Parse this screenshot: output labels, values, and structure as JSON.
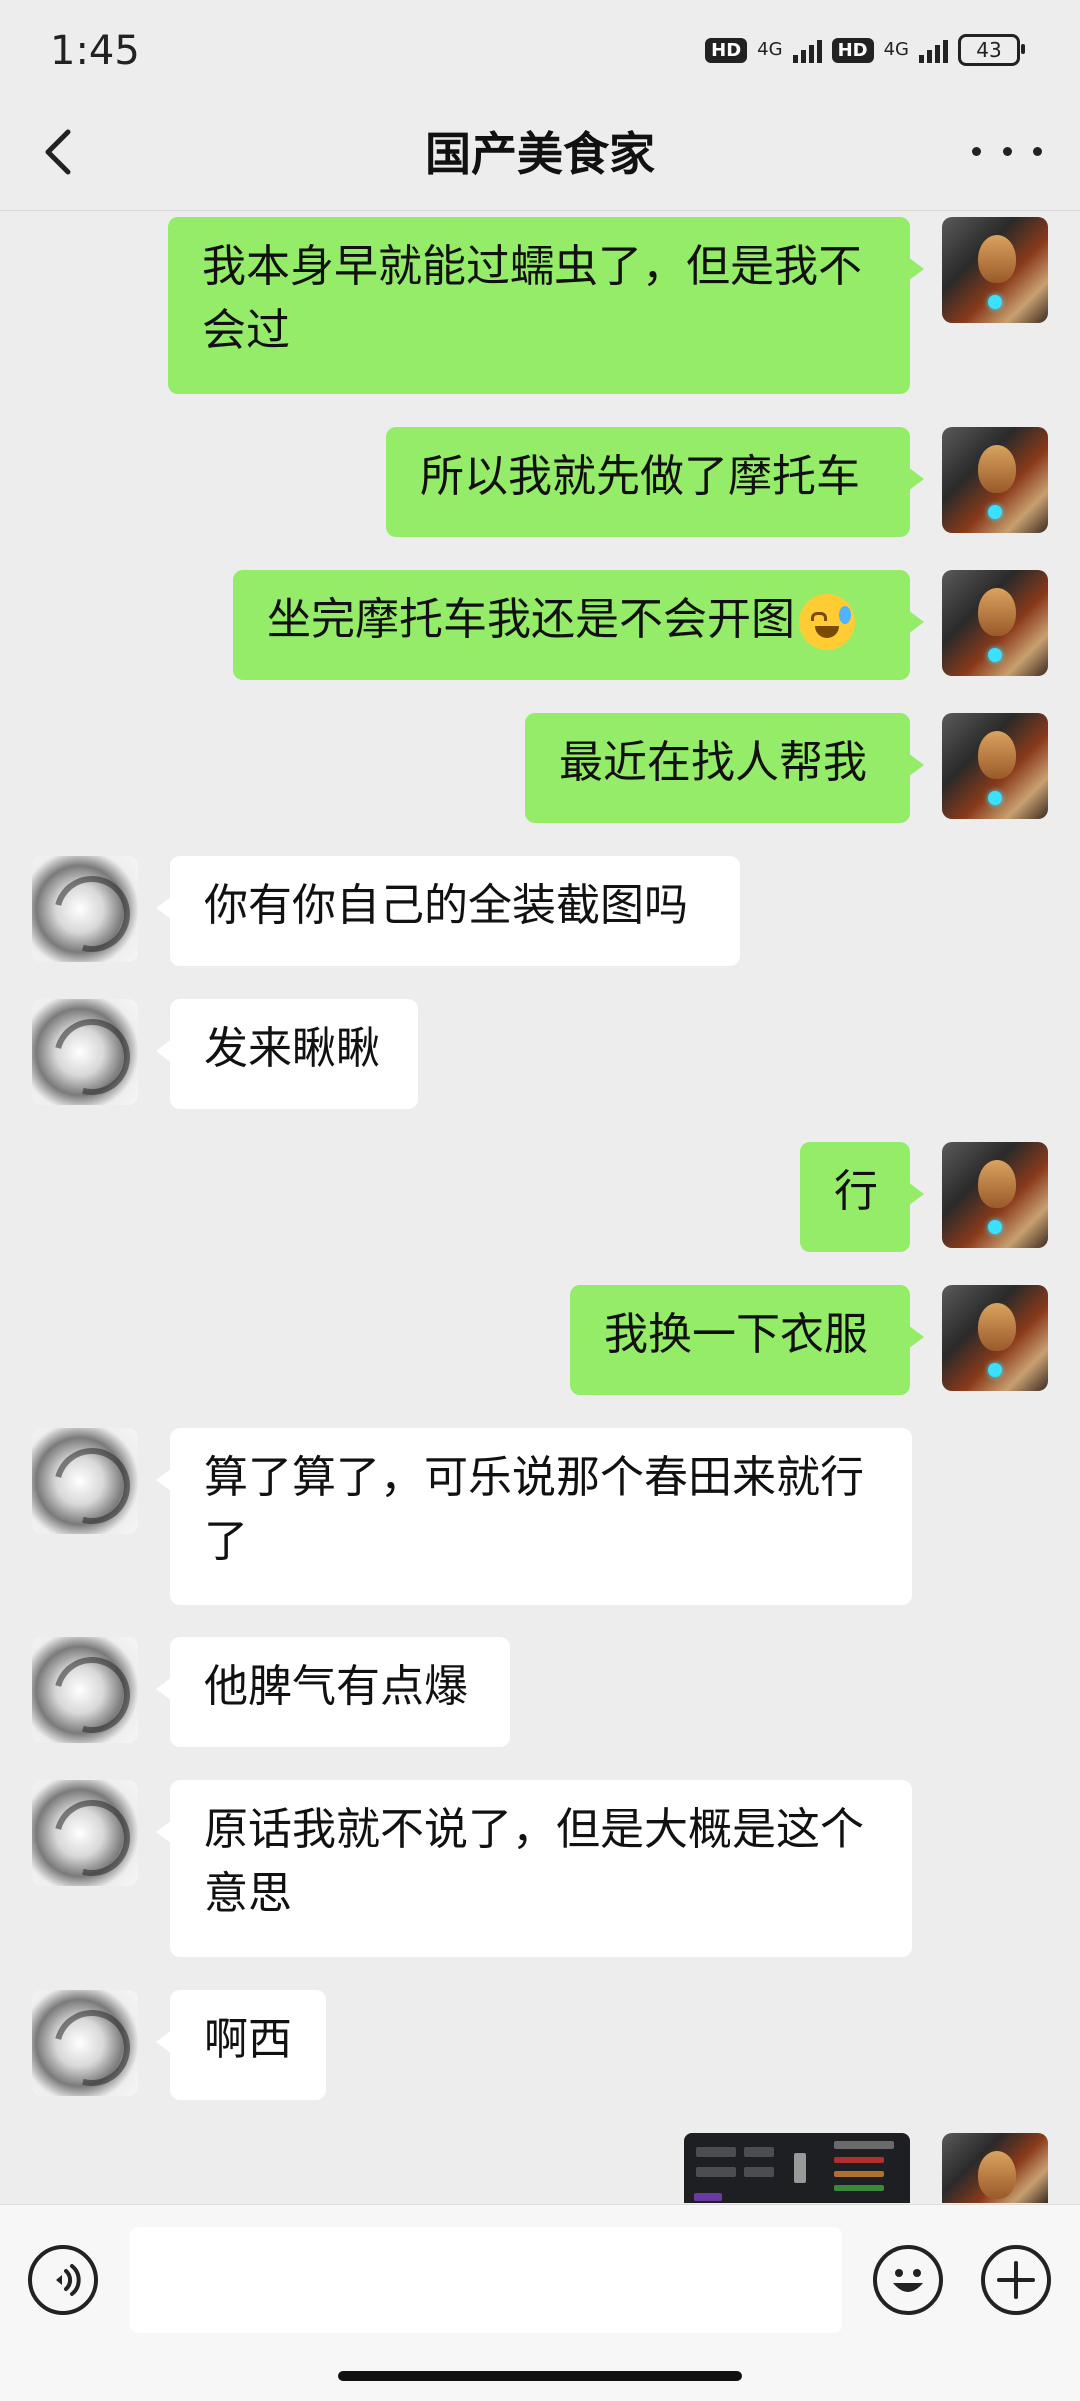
{
  "status_bar": {
    "time": "1:45",
    "hd1": "HD",
    "net1": "4G",
    "hd2": "HD",
    "net2": "4G",
    "battery": "43"
  },
  "header": {
    "title": "国产美食家",
    "back_icon": "chevron-left-icon",
    "more_icon": "more-dots-icon"
  },
  "messages": [
    {
      "from": "me",
      "text": "我本身早就能过蠕虫了，但是我不会过"
    },
    {
      "from": "me",
      "text": "所以我就先做了摩托车"
    },
    {
      "from": "me",
      "text": "坐完摩托车我还是不会开图",
      "emoji": "crying-laughing-emoji"
    },
    {
      "from": "me",
      "text": "最近在找人帮我"
    },
    {
      "from": "other",
      "text": "你有你自己的全装截图吗"
    },
    {
      "from": "other",
      "text": "发来瞅瞅"
    },
    {
      "from": "me",
      "text": "行"
    },
    {
      "from": "me",
      "text": "我换一下衣服"
    },
    {
      "from": "other",
      "text": "算了算了，可乐说那个春田来就行了"
    },
    {
      "from": "other",
      "text": "他脾气有点爆"
    },
    {
      "from": "other",
      "text": "原话我就不说了，但是大概是这个意思"
    },
    {
      "from": "other",
      "text": "啊西"
    },
    {
      "from": "me",
      "type": "image",
      "icon": "game-screenshot-image"
    }
  ],
  "input_bar": {
    "voice_icon": "voice-input-icon",
    "emoji_icon": "emoji-icon",
    "plus_icon": "plus-icon",
    "text_value": ""
  },
  "colors": {
    "my_bubble": "#95ec69",
    "other_bubble": "#ffffff",
    "background": "#ededed"
  }
}
